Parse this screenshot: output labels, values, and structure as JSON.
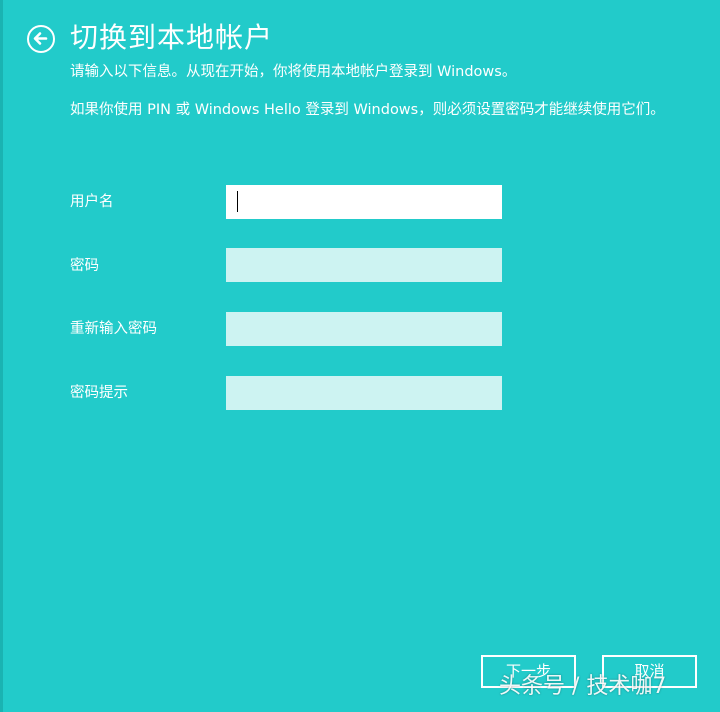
{
  "header": {
    "title": "切换到本地帐户",
    "back_icon": "back-arrow-circle-icon"
  },
  "description": {
    "line1": "请输入以下信息。从现在开始，你将使用本地帐户登录到 Windows。",
    "line2": "如果你使用 PIN 或 Windows Hello 登录到 Windows，则必须设置密码才能继续使用它们。"
  },
  "form": {
    "username": {
      "label": "用户名",
      "value": ""
    },
    "password": {
      "label": "密码",
      "value": ""
    },
    "password_confirm": {
      "label": "重新输入密码",
      "value": ""
    },
    "password_hint": {
      "label": "密码提示",
      "value": ""
    }
  },
  "buttons": {
    "next": "下一步",
    "cancel": "取消"
  },
  "watermark": "头条号 / 技术咖7",
  "colors": {
    "background": "#22cbca",
    "active_field": "#ffffff",
    "inactive_field": "#cdf3f2",
    "text": "#ffffff"
  }
}
